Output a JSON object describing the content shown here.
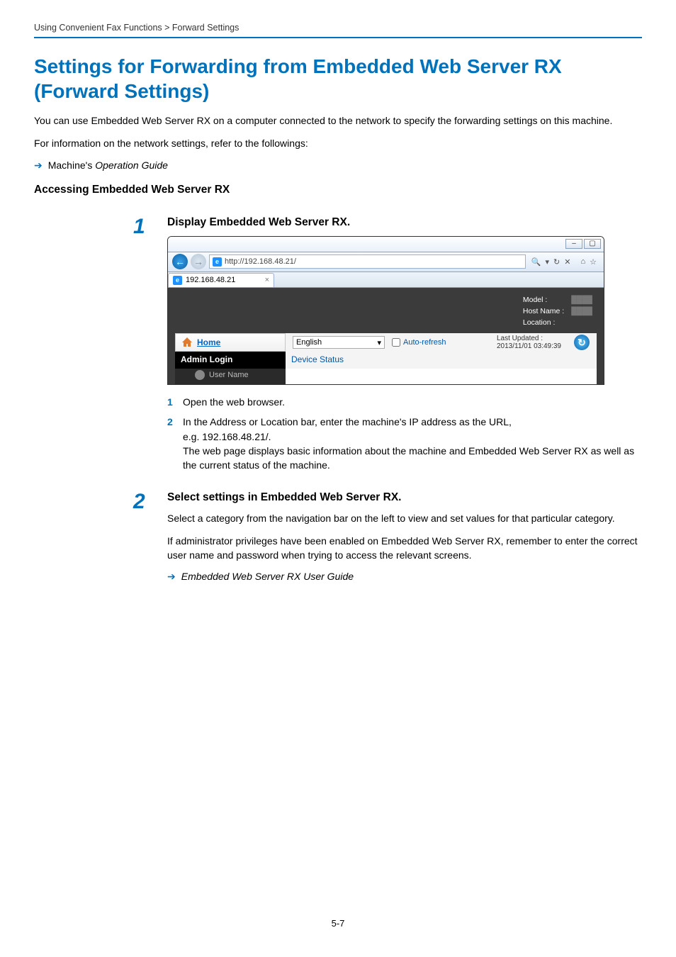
{
  "breadcrumb": "Using Convenient Fax Functions > Forward Settings",
  "title": "Settings for Forwarding from Embedded Web Server RX (Forward Settings)",
  "intro1": "You can use Embedded Web Server RX on a computer connected to the network to specify the forwarding settings on this machine.",
  "intro2": "For information on the network settings, refer to the followings:",
  "xref1_prefix": "Machine's ",
  "xref1_italic": "Operation Guide",
  "subhead": "Accessing Embedded Web Server RX",
  "step1": {
    "num": "1",
    "title": "Display Embedded Web Server RX.",
    "sub1_num": "1",
    "sub1_text": "Open the web browser.",
    "sub2_num": "2",
    "sub2_line1": "In the Address or Location bar, enter the machine's IP address as the URL,",
    "sub2_line2": "e.g. 192.168.48.21/.",
    "sub2_line3": "The web page displays basic information about the machine and Embedded Web Server RX as well as the current status of the machine."
  },
  "step2": {
    "num": "2",
    "title": "Select settings in Embedded Web Server RX.",
    "para1": "Select a category from the navigation bar on the left to view and set values for that particular category.",
    "para2": "If administrator privileges have been enabled on Embedded Web Server RX, remember to enter the correct user name and password when trying to access the relevant screens.",
    "xref_italic": "Embedded Web Server RX User Guide"
  },
  "browser": {
    "url": "http://192.168.48.21/",
    "tab": "192.168.48.21",
    "search_glyph": "🔍",
    "refresh_glyph": "↻",
    "stop_glyph": "✕",
    "home_glyph": "⌂",
    "star_glyph": "☆",
    "minimize": "–",
    "maximize": "▢",
    "model_label": "Model :",
    "hostname_label": "Host Name :",
    "location_label": "Location :",
    "home_link": "Home",
    "language": "English",
    "auto_refresh": "Auto-refresh",
    "last_updated_label": "Last Updated :",
    "last_updated_value": "2013/11/01 03:49:39",
    "admin_login": "Admin Login",
    "device_status": "Device Status",
    "user_name": "User Name"
  },
  "page_number": "5-7"
}
